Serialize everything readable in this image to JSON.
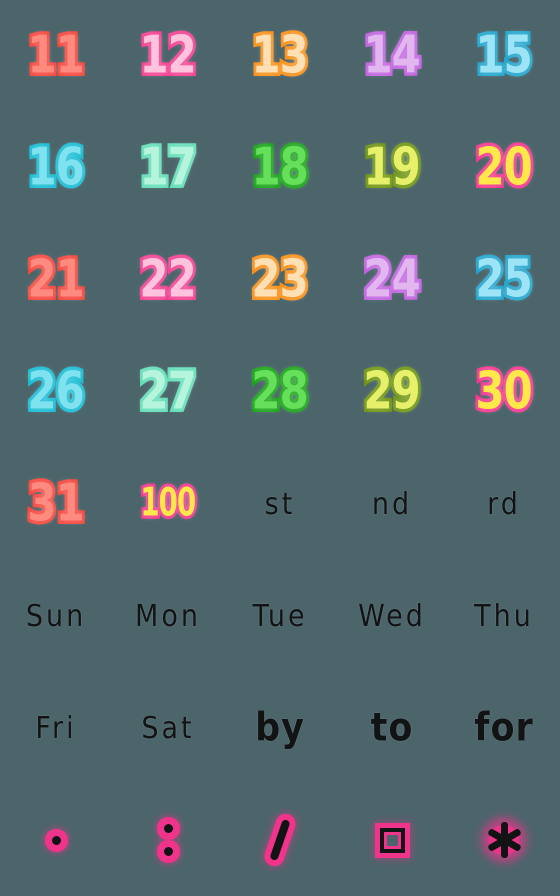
{
  "sheet": {
    "background_color": "#4c656b",
    "columns": 5,
    "rows": 8
  },
  "palette": {
    "red_core": "#ff8a80",
    "red_edge": "#f5463c",
    "pink_core": "#ffc4dd",
    "pink_edge": "#f53f92",
    "orange_core": "#ffe0b5",
    "orange_edge": "#f99018",
    "purple_core": "#e2b6ef",
    "purple_edge": "#c162e0",
    "blue_core": "#9de4f7",
    "blue_edge": "#21a5cc",
    "cyan_core": "#7fe2ee",
    "cyan_edge": "#17bcd4",
    "mint_core": "#b6f4dd",
    "mint_edge": "#62dfb7",
    "green_core": "#66e05a",
    "green_edge": "#17a316",
    "olive_core": "#e7f06a",
    "olive_edge": "#6e9412",
    "yellow_core": "#ffe94a",
    "yellow_edge": "#f5358f",
    "black": "#121315",
    "magenta": "#f0348c"
  },
  "cells": [
    {
      "kind": "number",
      "glyph": "11",
      "name": "sticker-number-11",
      "core": "#ff8a80",
      "edge": "#f5463c"
    },
    {
      "kind": "number",
      "glyph": "12",
      "name": "sticker-number-12",
      "core": "#ffc4dd",
      "edge": "#f53f92"
    },
    {
      "kind": "number",
      "glyph": "13",
      "name": "sticker-number-13",
      "core": "#ffe0b5",
      "edge": "#f99018"
    },
    {
      "kind": "number",
      "glyph": "14",
      "name": "sticker-number-14",
      "core": "#e2b6ef",
      "edge": "#c162e0"
    },
    {
      "kind": "number",
      "glyph": "15",
      "name": "sticker-number-15",
      "core": "#9de4f7",
      "edge": "#21a5cc"
    },
    {
      "kind": "number",
      "glyph": "16",
      "name": "sticker-number-16",
      "core": "#7fe2ee",
      "edge": "#17bcd4"
    },
    {
      "kind": "number",
      "glyph": "17",
      "name": "sticker-number-17",
      "core": "#b6f4dd",
      "edge": "#62dfb7"
    },
    {
      "kind": "number",
      "glyph": "18",
      "name": "sticker-number-18",
      "core": "#66e05a",
      "edge": "#17a316"
    },
    {
      "kind": "number",
      "glyph": "19",
      "name": "sticker-number-19",
      "core": "#e7f06a",
      "edge": "#6e9412"
    },
    {
      "kind": "number",
      "glyph": "20",
      "name": "sticker-number-20",
      "core": "#ffe94a",
      "edge": "#f5358f"
    },
    {
      "kind": "number",
      "glyph": "21",
      "name": "sticker-number-21",
      "core": "#ff8a80",
      "edge": "#f5463c"
    },
    {
      "kind": "number",
      "glyph": "22",
      "name": "sticker-number-22",
      "core": "#ffc4dd",
      "edge": "#f53f92"
    },
    {
      "kind": "number",
      "glyph": "23",
      "name": "sticker-number-23",
      "core": "#ffe0b5",
      "edge": "#f99018"
    },
    {
      "kind": "number",
      "glyph": "24",
      "name": "sticker-number-24",
      "core": "#e2b6ef",
      "edge": "#c162e0"
    },
    {
      "kind": "number",
      "glyph": "25",
      "name": "sticker-number-25",
      "core": "#9de4f7",
      "edge": "#21a5cc"
    },
    {
      "kind": "number",
      "glyph": "26",
      "name": "sticker-number-26",
      "core": "#7fe2ee",
      "edge": "#17bcd4"
    },
    {
      "kind": "number",
      "glyph": "27",
      "name": "sticker-number-27",
      "core": "#b6f4dd",
      "edge": "#62dfb7"
    },
    {
      "kind": "number",
      "glyph": "28",
      "name": "sticker-number-28",
      "core": "#66e05a",
      "edge": "#17a316"
    },
    {
      "kind": "number",
      "glyph": "29",
      "name": "sticker-number-29",
      "core": "#e7f06a",
      "edge": "#6e9412"
    },
    {
      "kind": "number",
      "glyph": "30",
      "name": "sticker-number-30",
      "core": "#ffe94a",
      "edge": "#f5358f"
    },
    {
      "kind": "number",
      "glyph": "31",
      "name": "sticker-number-31",
      "core": "#ff8a80",
      "edge": "#f5463c"
    },
    {
      "kind": "number-small",
      "glyph": "100",
      "name": "sticker-number-100",
      "core": "#ffe94a",
      "edge": "#f5358f"
    },
    {
      "kind": "word",
      "glyph": "st",
      "name": "sticker-ordinal-st"
    },
    {
      "kind": "word",
      "glyph": "nd",
      "name": "sticker-ordinal-nd"
    },
    {
      "kind": "word",
      "glyph": "rd",
      "name": "sticker-ordinal-rd"
    },
    {
      "kind": "word",
      "glyph": "Sun",
      "name": "sticker-weekday-sun"
    },
    {
      "kind": "word",
      "glyph": "Mon",
      "name": "sticker-weekday-mon"
    },
    {
      "kind": "word",
      "glyph": "Tue",
      "name": "sticker-weekday-tue"
    },
    {
      "kind": "word",
      "glyph": "Wed",
      "name": "sticker-weekday-wed"
    },
    {
      "kind": "word",
      "glyph": "Thu",
      "name": "sticker-weekday-thu"
    },
    {
      "kind": "word",
      "glyph": "Fri",
      "name": "sticker-weekday-fri"
    },
    {
      "kind": "word",
      "glyph": "Sat",
      "name": "sticker-weekday-sat"
    },
    {
      "kind": "word-heavy",
      "glyph": "by",
      "name": "sticker-word-by"
    },
    {
      "kind": "word-heavy",
      "glyph": "to",
      "name": "sticker-word-to"
    },
    {
      "kind": "word-heavy",
      "glyph": "for",
      "name": "sticker-word-for"
    },
    {
      "kind": "punct-dot",
      "glyph": ".",
      "name": "sticker-punct-period"
    },
    {
      "kind": "punct-colon",
      "glyph": ":",
      "name": "sticker-punct-colon"
    },
    {
      "kind": "punct-slash",
      "glyph": "/",
      "name": "sticker-punct-slash"
    },
    {
      "kind": "punct-square",
      "glyph": "square",
      "name": "sticker-punct-square"
    },
    {
      "kind": "punct-asterisk",
      "glyph": "*",
      "name": "sticker-punct-asterisk"
    }
  ]
}
